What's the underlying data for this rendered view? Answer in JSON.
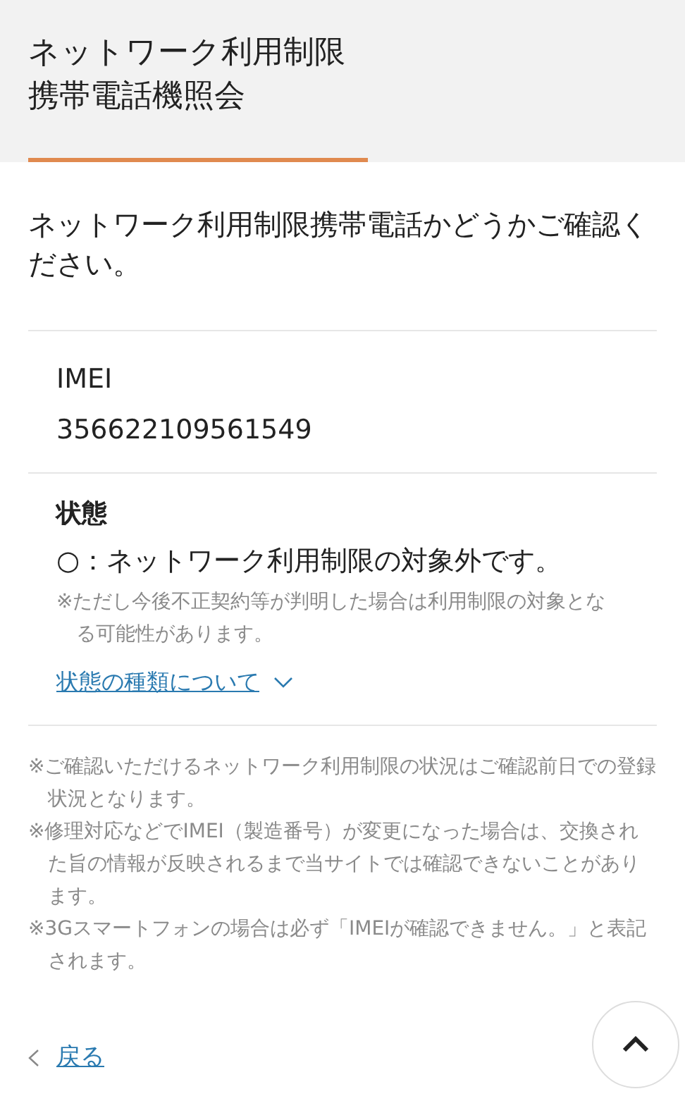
{
  "header": {
    "title": "ネットワーク利用制限携帯電話機照会"
  },
  "intro": "ネットワーク利用制限携帯電話かどうかご確認ください。",
  "imei": {
    "label": "IMEI",
    "value": "356622109561549"
  },
  "status": {
    "label": "状態",
    "result": "○：ネットワーク利用制限の対象外です。",
    "note": "※ただし今後不正契約等が判明した場合は利用制限の対象となる可能性があります。",
    "link": {
      "label": "状態の種類について",
      "expanded": false
    }
  },
  "notes": [
    "※ご確認いただけるネットワーク利用制限の状況はご確認前日での登録状況となります。",
    "※修理対応などでIMEI（製造番号）が変更になった場合は、交換された旨の情報が反映されるまで当サイトでは確認できないことがあります。",
    "※3Gスマートフォンの場合は必ず「IMEIが確認できません。」と表記されます。"
  ],
  "back_link": "戻る"
}
